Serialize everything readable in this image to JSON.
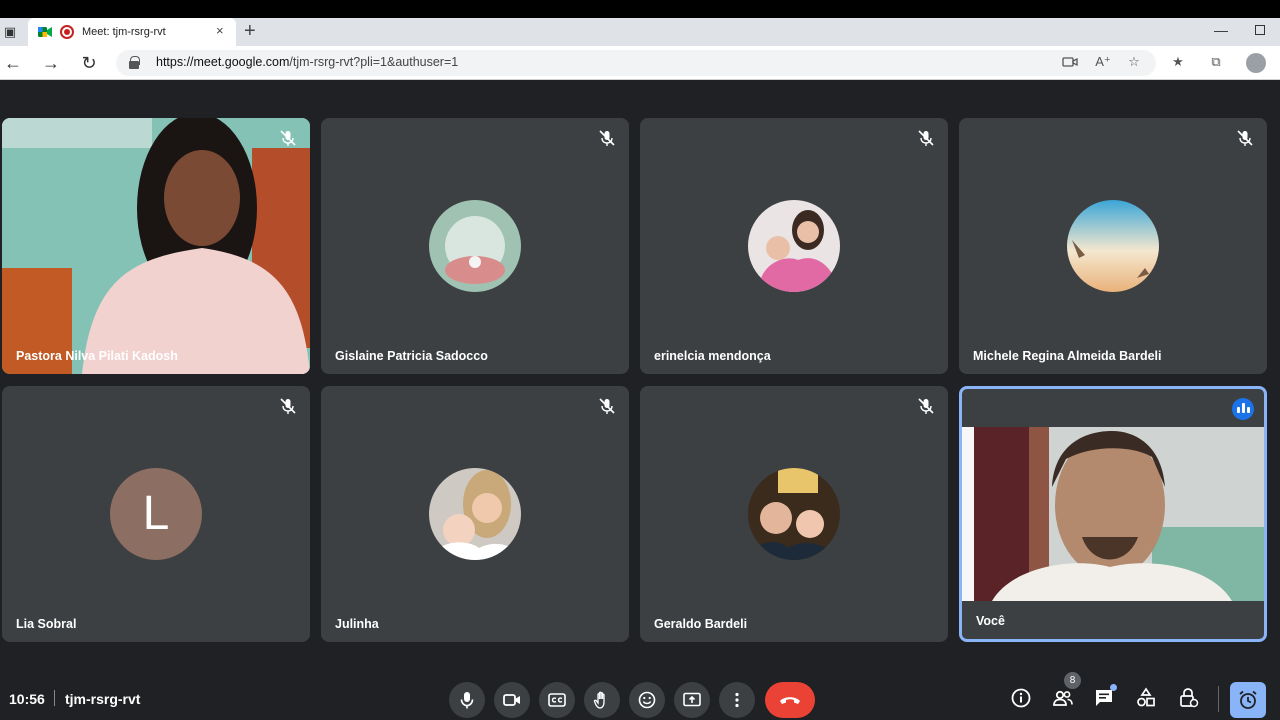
{
  "browser": {
    "tab_title": "Meet: tjm-rsrg-rvt",
    "tab_close": "×",
    "new_tab": "+",
    "url_host": "https://meet.google.com",
    "url_path": "/tjm-rsrg-rvt?pli=1&authuser=1",
    "minimize": "—"
  },
  "participants": [
    {
      "name": "Pastora Nilva Pilati Kadosh",
      "muted": true,
      "video": true
    },
    {
      "name": "Gislaine Patricia Sadocco",
      "muted": true,
      "video": false
    },
    {
      "name": "erinelcia mendonça",
      "muted": true,
      "video": false
    },
    {
      "name": "Michele Regina Almeida Bardeli",
      "muted": true,
      "video": false
    },
    {
      "name": "Lia Sobral",
      "muted": true,
      "video": false,
      "avatar_letter": "L"
    },
    {
      "name": "Julinha",
      "muted": true,
      "video": false
    },
    {
      "name": "Geraldo Bardeli",
      "muted": true,
      "video": false
    },
    {
      "name": "Você",
      "muted": false,
      "video": true,
      "speaking": true
    }
  ],
  "bottom": {
    "time": "10:56",
    "meeting_code": "tjm-rsrg-rvt",
    "people_count": "8"
  },
  "colors": {
    "background": "#202124",
    "tile": "#3c4043",
    "hangup": "#ea4335",
    "accent": "#8ab4f8",
    "speaking": "#1a73e8"
  }
}
